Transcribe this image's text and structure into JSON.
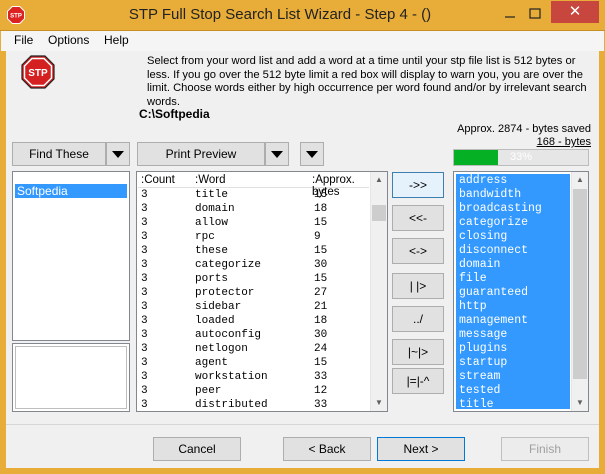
{
  "window": {
    "title": "STP Full Stop Search List Wizard - Step 4 - ()",
    "app_icon_text": "STP",
    "minimize_glyph": "–",
    "maximize_glyph": "□",
    "close_glyph": "✕"
  },
  "menu": [
    "File",
    "Options",
    "Help"
  ],
  "instructions": "Select from your word list and add a word at a time until your stp file list is 512 bytes or less. If you go over the 512 byte limit a red box will display to warn you, you are over the limit. Choose words either by high occurrence per word found and/or by irrelevant search words.",
  "stop_icon_text": "STP",
  "path": "C:\\Softpedia",
  "approx_saved": "Approx. 2874 - bytes saved",
  "bytes_link": "168 - bytes",
  "progress": {
    "value": 0.33,
    "label": "33%"
  },
  "buttons": {
    "find_these": "Find These",
    "print_preview": "Print Preview",
    "cancel": "Cancel",
    "back": "< Back",
    "next": "Next >",
    "finish": "Finish"
  },
  "left_list": [
    "Softpedia"
  ],
  "table": {
    "headers": [
      ":Count",
      ":Word",
      ":Approx. bytes"
    ],
    "rows": [
      [
        "3",
        "title",
        "15"
      ],
      [
        "3",
        "domain",
        "18"
      ],
      [
        "3",
        "allow",
        "15"
      ],
      [
        "3",
        "rpc",
        "9"
      ],
      [
        "3",
        "these",
        "15"
      ],
      [
        "3",
        "categorize",
        "30"
      ],
      [
        "3",
        "ports",
        "15"
      ],
      [
        "3",
        "protector",
        "27"
      ],
      [
        "3",
        "sidebar",
        "21"
      ],
      [
        "3",
        "loaded",
        "18"
      ],
      [
        "3",
        "autoconfig",
        "30"
      ],
      [
        "3",
        "netlogon",
        "24"
      ],
      [
        "3",
        "agent",
        "15"
      ],
      [
        "3",
        "workstation",
        "33"
      ],
      [
        "3",
        "peer",
        "12"
      ],
      [
        "3",
        "distributed",
        "33"
      ]
    ]
  },
  "mid_buttons": [
    "->>",
    "<<-",
    "<->",
    "| |>",
    "../",
    "|~|>",
    "|=|-^"
  ],
  "selected_words": [
    "address",
    "bandwidth",
    "broadcasting",
    "categorize",
    "closing",
    "disconnect",
    "domain",
    "file",
    "guaranteed",
    "http",
    "management",
    "message",
    "plugins",
    "startup",
    "stream",
    "tested",
    "title"
  ],
  "colors": {
    "titlebar": "#e8ad39",
    "selection": "#3399ff",
    "progress": "#06b025"
  }
}
